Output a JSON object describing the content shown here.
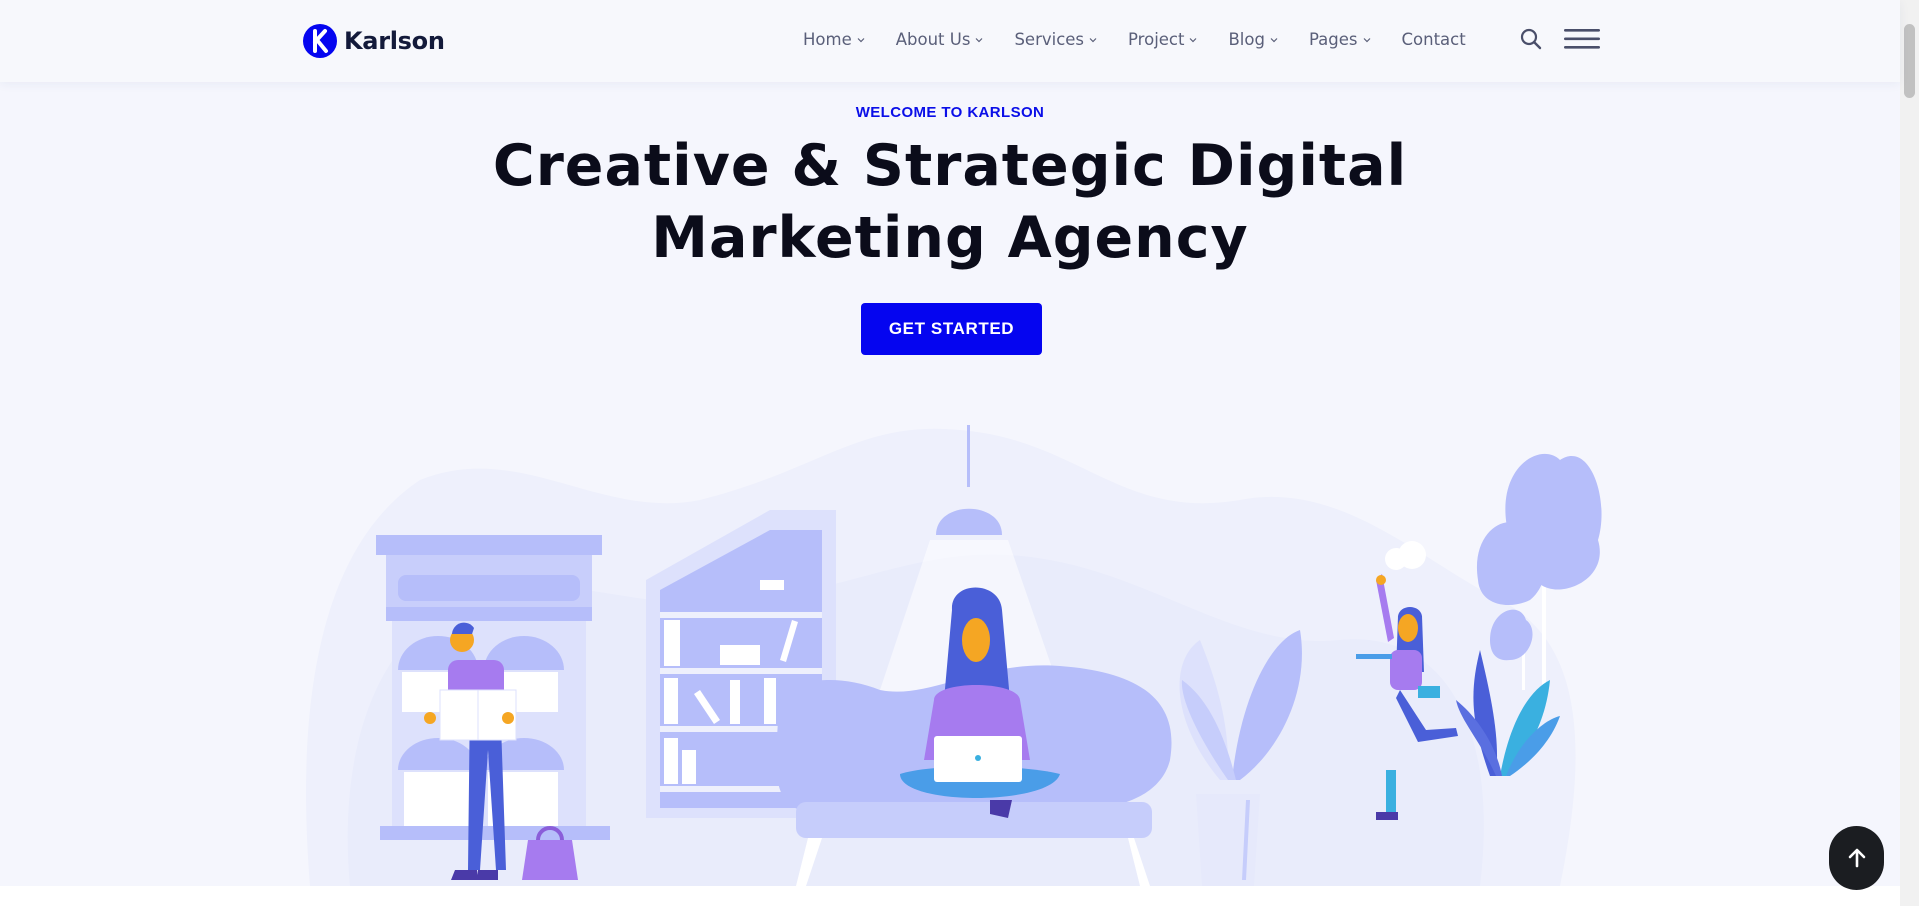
{
  "brand": {
    "name": "Karlson",
    "color": "#0505f0"
  },
  "nav": {
    "items": [
      {
        "label": "Home",
        "has_dropdown": true
      },
      {
        "label": "About Us",
        "has_dropdown": true
      },
      {
        "label": "Services",
        "has_dropdown": true
      },
      {
        "label": "Project",
        "has_dropdown": true
      },
      {
        "label": "Blog",
        "has_dropdown": true
      },
      {
        "label": "Pages",
        "has_dropdown": true
      },
      {
        "label": "Contact",
        "has_dropdown": false
      }
    ],
    "search_icon": "search-icon",
    "menu_icon": "hamburger-menu-icon"
  },
  "hero": {
    "kicker": "WELCOME TO KARLSON",
    "title_line1": "Creative & Strategic Digital",
    "title_line2": "Marketing Agency",
    "cta_label": "GET STARTED"
  },
  "illustration": {
    "icon": "office-scene-illustration",
    "palette": {
      "light": "#b6befa",
      "pale": "#e6e9fb",
      "purple": "#a67bef",
      "blue": "#4a5fd8",
      "orange": "#f5a623"
    }
  },
  "scroll_top_icon": "arrow-up-icon"
}
